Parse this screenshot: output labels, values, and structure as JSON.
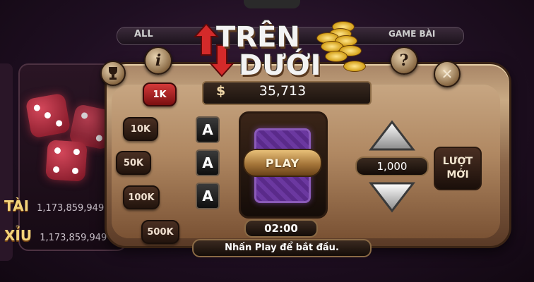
{
  "background": {
    "tabs": {
      "all": "ALL",
      "game_bai": "GAME BÀI"
    },
    "rows": [
      {
        "label": "TÀI",
        "value": "1,173,859,949"
      },
      {
        "label": "XỈU",
        "value": "1,173,859,949"
      }
    ]
  },
  "logo": {
    "line1": "TRÊN",
    "line2": "DƯỚI"
  },
  "header_buttons": {
    "info": "i",
    "help": "?",
    "close": "✕",
    "trophy": "trophy-icon"
  },
  "balance": {
    "currency_symbol": "$",
    "value": "35,713"
  },
  "chips": [
    {
      "label": "1K",
      "active": true
    },
    {
      "label": "10K",
      "active": false
    },
    {
      "label": "50K",
      "active": false
    },
    {
      "label": "100K",
      "active": false
    },
    {
      "label": "500K",
      "active": false
    }
  ],
  "history_cards": [
    "A",
    "A",
    "A"
  ],
  "play_button": "PLAY",
  "timer": "02:00",
  "status": "Nhấn Play để bắt đầu.",
  "bet_amount": "1,000",
  "new_turn": {
    "line1": "LƯỢT",
    "line2": "MỚI"
  },
  "colors": {
    "active_chip": "#d43a3a",
    "card_back": "#6b38a0",
    "panel_gold": "#c9aa84"
  }
}
